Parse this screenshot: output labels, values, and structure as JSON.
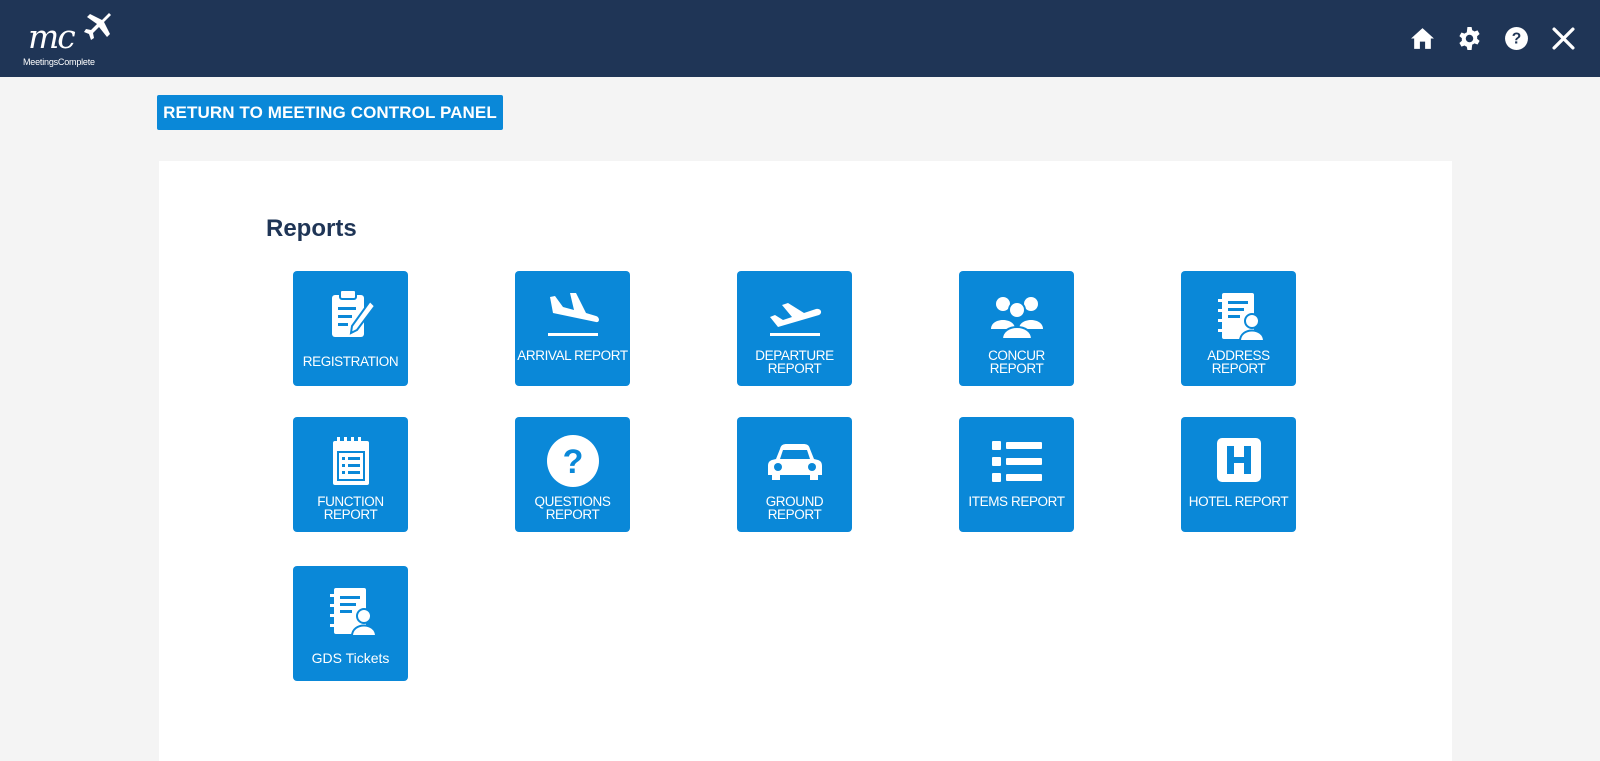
{
  "header": {
    "logo_text": "mc",
    "logo_subtext": "MeetingsComplete",
    "icons": [
      "home-icon",
      "gear-icon",
      "help-icon",
      "close-icon"
    ]
  },
  "return_button": {
    "label": "RETURN TO MEETING CONTROL PANEL"
  },
  "reports": {
    "title": "Reports",
    "tiles": [
      {
        "label": "REGISTRATION",
        "icon": "clipboard-edit-icon"
      },
      {
        "label": "ARRIVAL REPORT",
        "icon": "plane-landing-icon"
      },
      {
        "label": "DEPARTURE REPORT",
        "icon": "plane-takeoff-icon"
      },
      {
        "label": "CONCUR REPORT",
        "icon": "users-group-icon"
      },
      {
        "label": "ADDRESS REPORT",
        "icon": "address-book-icon"
      },
      {
        "label": "FUNCTION REPORT",
        "icon": "calendar-list-icon"
      },
      {
        "label": "QUESTIONS REPORT",
        "icon": "question-circle-icon"
      },
      {
        "label": "GROUND REPORT",
        "icon": "car-icon"
      },
      {
        "label": "ITEMS REPORT",
        "icon": "list-icon"
      },
      {
        "label": "HOTEL REPORT",
        "icon": "hotel-icon"
      },
      {
        "label": "GDS Tickets",
        "icon": "address-book-icon"
      }
    ]
  },
  "colors": {
    "header_bg": "#1f3556",
    "accent": "#0a88d8",
    "page_bg": "#f4f4f4",
    "title_text": "#1f3556"
  }
}
